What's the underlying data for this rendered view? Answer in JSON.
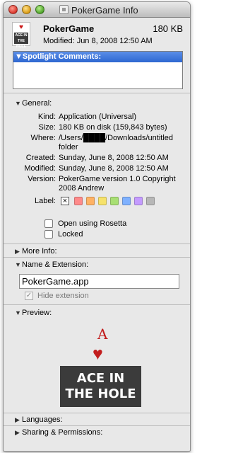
{
  "window": {
    "title": "PokerGame Info"
  },
  "header": {
    "app_name": "PokerGame",
    "size": "180 KB",
    "modified": "Modified: Jun 8, 2008 12:50 AM"
  },
  "spotlight": {
    "label": "Spotlight Comments:",
    "comment": ""
  },
  "general": {
    "label": "General:",
    "kind_label": "Kind:",
    "kind": "Application (Universal)",
    "size_label": "Size:",
    "size": "180 KB on disk (159,843 bytes)",
    "where_label": "Where:",
    "where_line1": "/Users/████/Downloads/untitled",
    "where_line2": "folder",
    "created_label": "Created:",
    "created": "Sunday, June 8, 2008 12:50 AM",
    "modified_label": "Modified:",
    "modified": "Sunday, June 8, 2008 12:50 AM",
    "version_label": "Version:",
    "version_line1": "PokerGame version 1.0 Copyright",
    "version_line2": "2008 Andrew",
    "label_label": "Label:",
    "label_x": "×",
    "label_swatches": [
      "#ff8a8a",
      "#ffb264",
      "#f6e26b",
      "#a8df73",
      "#7fb1ff",
      "#c49bff",
      "#b7b7b7"
    ],
    "rosetta": "Open using Rosetta",
    "locked": "Locked"
  },
  "more_info": {
    "label": "More Info:"
  },
  "name_extension": {
    "label": "Name & Extension:",
    "filename": "PokerGame.app",
    "hide_extension": "Hide extension",
    "hide_extension_checked": "✓"
  },
  "preview": {
    "label": "Preview:",
    "card_rank": "A",
    "card_suit": "♥",
    "logo_line1": "ACE IN",
    "logo_line2": "THE HOLE"
  },
  "languages": {
    "label": "Languages:"
  },
  "sharing": {
    "label": "Sharing & Permissions:"
  },
  "icons": {
    "collapsed": "▶",
    "expanded": "▼",
    "suit": "♥"
  }
}
